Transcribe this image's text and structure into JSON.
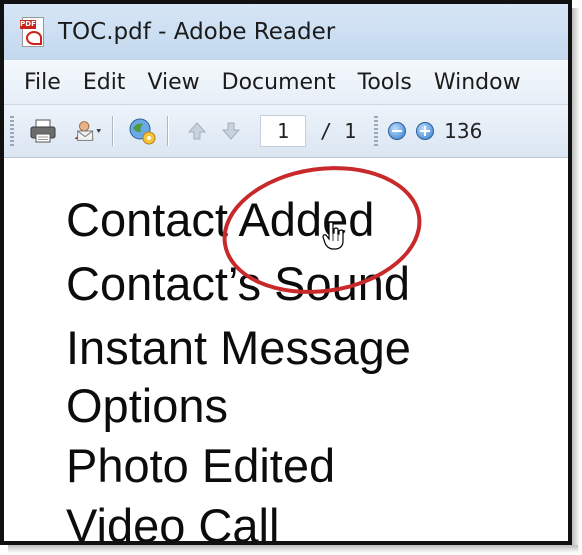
{
  "window": {
    "title": "TOC.pdf - Adobe Reader",
    "app_icon": "pdf-icon"
  },
  "menu": [
    "File",
    "Edit",
    "View",
    "Document",
    "Tools",
    "Window"
  ],
  "toolbar": {
    "icons": [
      "print-icon",
      "email-icon",
      "collaborate-icon",
      "previous-page-icon",
      "next-page-icon",
      "zoom-out-icon",
      "zoom-in-icon"
    ],
    "current_page": "1",
    "page_total": "/ 1",
    "zoom": "136"
  },
  "document": {
    "lines": [
      "Contact Added",
      "Contact’s Sound",
      "Instant Message",
      "Options",
      "Photo Edited",
      "Video Call"
    ]
  },
  "annotation": {
    "highlight_color": "#c8292b",
    "cursor": "hand-cursor-icon"
  }
}
